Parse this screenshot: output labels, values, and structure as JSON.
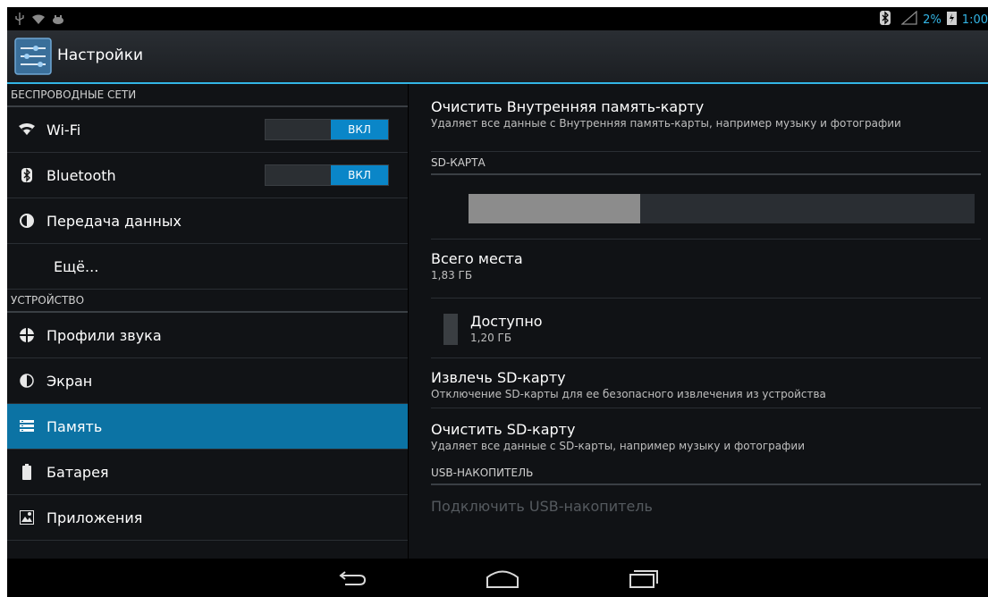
{
  "status_bar": {
    "left_icons": [
      "usb-icon",
      "wifi-icon",
      "android-debug-icon"
    ],
    "battery": "2%",
    "time": "1:00",
    "accent_color": "#33b5e5"
  },
  "action_bar": {
    "title": "Настройки",
    "icon": "settings-sliders-icon"
  },
  "left_pane": {
    "sections": [
      {
        "header": "БЕСПРОВОДНЫЕ СЕТИ",
        "items": [
          {
            "label": "Wi-Fi",
            "icon": "wifi-icon",
            "toggle": "ВКЛ"
          },
          {
            "label": "Bluetooth",
            "icon": "bluetooth-icon",
            "toggle": "ВКЛ"
          },
          {
            "label": "Передача данных",
            "icon": "data-usage-icon"
          },
          {
            "label": "Ещё..."
          }
        ]
      },
      {
        "header": "УСТРОЙСТВО",
        "items": [
          {
            "label": "Профили звука",
            "icon": "sound-profiles-icon"
          },
          {
            "label": "Экран",
            "icon": "display-icon"
          },
          {
            "label": "Память",
            "icon": "storage-icon",
            "selected": true
          },
          {
            "label": "Батарея",
            "icon": "battery-icon"
          },
          {
            "label": "Приложения",
            "icon": "apps-icon"
          }
        ]
      }
    ],
    "selected_color": "#0c73a4"
  },
  "right_pane": {
    "erase_internal": {
      "title": "Очистить Внутренняя память-карту",
      "subtitle": "Удаляет все данные с Внутренняя память-карты, например музыку и фотографии"
    },
    "sd_header": "SD-КАРТА",
    "sd_usage_fraction": 0.34,
    "total": {
      "title": "Всего места",
      "value": "1,83 ГБ"
    },
    "available": {
      "title": "Доступно",
      "value": "1,20 ГБ"
    },
    "unmount": {
      "title": "Извлечь SD-карту",
      "subtitle": "Отключение SD-карты для ее безопасного извлечения из устройства"
    },
    "erase_sd": {
      "title": "Очистить SD-карту",
      "subtitle": "Удаляет все данные с SD-карты, например музыку и фотографии"
    },
    "usb_header": "USB-НАКОПИТЕЛЬ",
    "usb_connect": {
      "title": "Подключить USB-накопитель",
      "disabled": true
    }
  },
  "nav_bar": {
    "buttons": [
      "back-icon",
      "home-icon",
      "recent-apps-icon"
    ]
  }
}
